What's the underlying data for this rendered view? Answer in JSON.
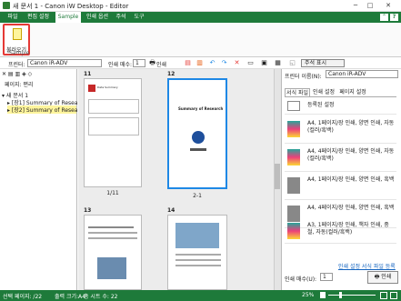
{
  "window": {
    "title": "새 문서 1 - Canon iW Desktop - Editor",
    "help_icon": "?"
  },
  "tabs": [
    {
      "label": "파일"
    },
    {
      "label": "편집 설정"
    },
    {
      "label": "Sample"
    },
    {
      "label": "인쇄 옵션"
    },
    {
      "label": "주석"
    },
    {
      "label": "도구"
    }
  ],
  "ribbon": {
    "open_label": "불러오기",
    "group_label": "Sample"
  },
  "toolbar": {
    "printer_label": "프린터:",
    "printer_value": "Canon iR-ADV",
    "copies_label": "인쇄 매수:",
    "copies_value": "1",
    "print_button_label": "인쇄",
    "annotation_button_label": "주석 표시"
  },
  "left_panel": {
    "header": "페이지: 편리",
    "tree": [
      {
        "label": "새 문서 1"
      },
      {
        "label": "[장1] Summary of Resea"
      },
      {
        "label": "[장2] Summary of Resea"
      }
    ]
  },
  "pages": [
    {
      "num": "11",
      "caption": "1/11",
      "heading": "Data Summary",
      "subheading": ""
    },
    {
      "num": "12",
      "caption": "2-1",
      "heading": "Summary of Research",
      "subheading": ""
    },
    {
      "num": "13",
      "caption": "",
      "heading": "",
      "subheading": ""
    },
    {
      "num": "14",
      "caption": "",
      "heading": "",
      "subheading": ""
    }
  ],
  "right_panel": {
    "printer_label": "프린터 이름(N):",
    "printer_value": "Canon iR-ADV",
    "tabs": [
      "서식 파일",
      "인쇄 설정",
      "페이지 설정"
    ],
    "settings": [
      {
        "text": "등록된 설정"
      },
      {
        "text": "A4, 1페이지/장 인쇄, 양면 인쇄, 자동(컬러/흑백)"
      },
      {
        "text": "A4, 4페이지/장 인쇄, 양면 인쇄, 자동(컬러/흑백)"
      },
      {
        "text": "A4, 1페이지/장 인쇄, 양면 인쇄, 흑백"
      },
      {
        "text": "A4, 4페이지/장 인쇄, 양면 인쇄, 흑백"
      },
      {
        "text": "A3, 1페이지/장 인쇄, 책자 인쇄, 중철, 자동(컬러/흑백)"
      }
    ],
    "link_text": "인쇄 설정 서식 파일 등록",
    "copies_label": "인쇄 매수(U):",
    "copies_value": "1",
    "print_label": "인쇄"
  },
  "status": {
    "selected_pages": "선택 페이지: /22",
    "output_size": "출력 크기:A4",
    "total_pages": "총 시트 수: 22",
    "zoom": "25%"
  }
}
